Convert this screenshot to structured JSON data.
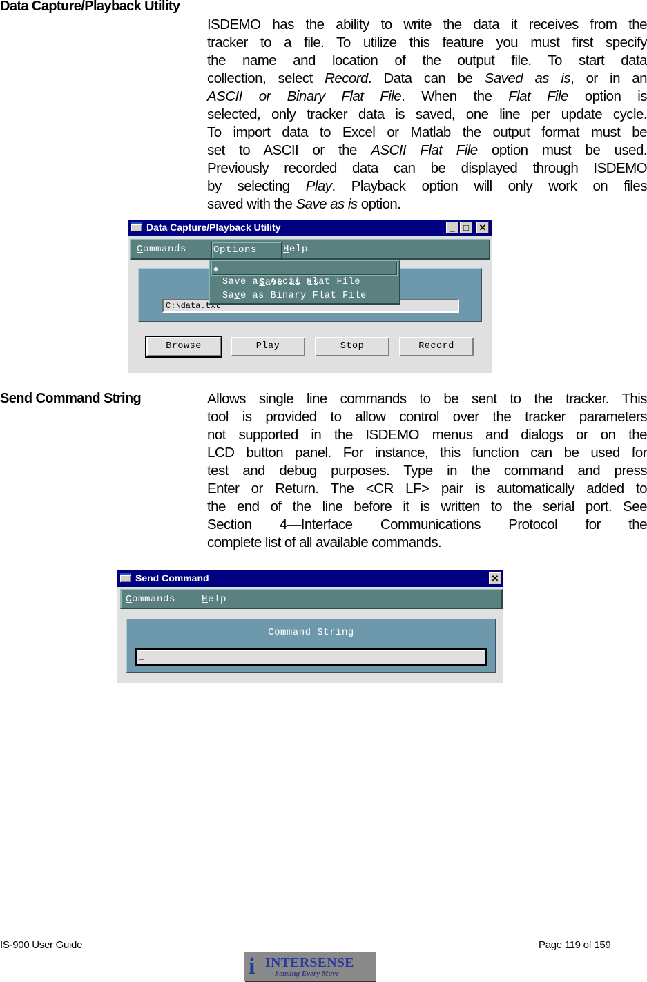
{
  "sections": {
    "data_capture": {
      "heading": "Data Capture/Playback Utility",
      "lines": [
        [
          "ISDEMO has the ability to write the data it receives from the"
        ],
        [
          "tracker to a file.  To utilize this feature you must first specify"
        ],
        [
          "the  name  and  location  of  the  output  file.   To  start  data"
        ],
        [
          "collection, select ",
          {
            "i": "Record"
          },
          ".  Data can be ",
          {
            "i": "Saved as is"
          },
          ", or in an"
        ],
        [
          {
            "i": "ASCII  or  Binary  Flat  File"
          },
          ".   When  the  ",
          {
            "i": "Flat  File"
          },
          "  option  is"
        ],
        [
          "selected, only tracker data is saved, one line per update cycle."
        ],
        [
          "To import data to Excel or Matlab the output format must be"
        ],
        [
          "set  to  ASCII  or  the  ",
          {
            "i": "ASCII  Flat  File"
          },
          "  option  must  be  used."
        ],
        [
          "Previously recorded data can be displayed through ISDEMO"
        ],
        [
          "by  selecting  ",
          {
            "i": "Play"
          },
          ".   Playback  option  will  only  work  on  files"
        ],
        [
          "saved with the ",
          {
            "i": "Save as is"
          },
          " option."
        ]
      ]
    },
    "send_command": {
      "heading": "Send Command String",
      "lines": [
        [
          "Allows single line commands to be sent to the tracker.  This"
        ],
        [
          "tool  is  provided  to  allow  control  over  the  tracker  parameters"
        ],
        [
          "not  supported  in  the  ISDEMO  menus  and  dialogs  or  on  the"
        ],
        [
          "LCD button panel.  For instance, this function can be used for"
        ],
        [
          "test  and  debug  purposes.   Type  in  the  command  and  press"
        ],
        [
          "Enter or Return.  The <CR LF> pair is automatically added to"
        ],
        [
          "the end of the line before it is written to the serial port.  See"
        ],
        [
          "Section   4—Interface   Communications   Protocol   for   the"
        ],
        [
          "complete list of all available commands."
        ]
      ]
    }
  },
  "capture_window": {
    "title": "Data Capture/Playback Utility",
    "controls": {
      "minimize": "_",
      "maximize": "□",
      "close": "✕"
    },
    "menu": [
      {
        "label": "Commands",
        "mnemonic": "C"
      },
      {
        "label": "Options",
        "mnemonic": "O",
        "open": true
      },
      {
        "label": "Help",
        "mnemonic": "H"
      }
    ],
    "options_dropdown": [
      {
        "label": "Save as is",
        "selected": true
      },
      {
        "label": "Save as Ascii Flat File",
        "selected": false
      },
      {
        "label": "Save as Binary Flat File",
        "selected": false
      }
    ],
    "selected_marker": "◆",
    "file_field": {
      "value": "C:\\data.txt"
    },
    "buttons": [
      {
        "label": "Browse",
        "default": true
      },
      {
        "label": "Play"
      },
      {
        "label": "Stop"
      },
      {
        "label": "Record"
      }
    ]
  },
  "send_window": {
    "title": "Send Command",
    "controls": {
      "close": "✕"
    },
    "menu": [
      {
        "label": "Commands",
        "mnemonic": "C"
      },
      {
        "label": "Help",
        "mnemonic": "H"
      }
    ],
    "panel_label": "Command String",
    "command_field": {
      "value": "",
      "cursor": "_"
    }
  },
  "footer": {
    "left": "IS-900 User Guide",
    "right": "Page 119 of 159",
    "logo": {
      "brand": "INTERSENSE",
      "tagline": "Sensing Every Move"
    }
  }
}
